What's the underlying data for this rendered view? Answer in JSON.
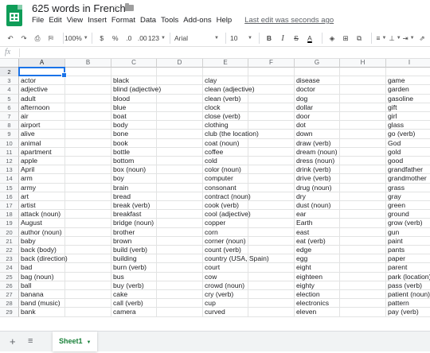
{
  "app": {
    "title": "625 words in French",
    "menu": [
      "File",
      "Edit",
      "View",
      "Insert",
      "Format",
      "Data",
      "Tools",
      "Add-ons",
      "Help"
    ],
    "last_edit": "Last edit was seconds ago",
    "accent": "#0f9d58"
  },
  "toolbar": {
    "zoom": "100%",
    "currency": "$",
    "percent": "%",
    "decimal_decrease": ".0",
    "decimal_increase": ".00",
    "more_formats": "123",
    "font": "Arial",
    "font_size": "10",
    "bold": "B",
    "italic": "I",
    "strike": "S",
    "text_color": "A"
  },
  "formula": {
    "fx": "fx",
    "value": ""
  },
  "grid": {
    "columns": [
      "A",
      "B",
      "C",
      "D",
      "E",
      "F",
      "G",
      "H",
      "I"
    ],
    "selected_column": "A",
    "active_cell": "A2",
    "rows": [
      {
        "n": "2",
        "cells": [
          "",
          "",
          "",
          "",
          "",
          "",
          "",
          "",
          ""
        ]
      },
      {
        "n": "3",
        "cells": [
          "actor",
          "",
          "black",
          "",
          "clay",
          "",
          "disease",
          "",
          "game"
        ]
      },
      {
        "n": "4",
        "cells": [
          "adjective",
          "",
          "blind (adjective)",
          "",
          "clean (adjective)",
          "",
          "doctor",
          "",
          "garden"
        ]
      },
      {
        "n": "5",
        "cells": [
          "adult",
          "",
          "blood",
          "",
          "clean (verb)",
          "",
          "dog",
          "",
          "gasoline"
        ]
      },
      {
        "n": "6",
        "cells": [
          "afternoon",
          "",
          "blue",
          "",
          "clock",
          "",
          "dollar",
          "",
          "gift"
        ]
      },
      {
        "n": "7",
        "cells": [
          "air",
          "",
          "boat",
          "",
          "close (verb)",
          "",
          "door",
          "",
          "girl"
        ]
      },
      {
        "n": "8",
        "cells": [
          "airport",
          "",
          "body",
          "",
          "clothing",
          "",
          "dot",
          "",
          "glass"
        ]
      },
      {
        "n": "9",
        "cells": [
          "alive",
          "",
          "bone",
          "",
          "club (the location)",
          "",
          "down",
          "",
          "go (verb)"
        ]
      },
      {
        "n": "10",
        "cells": [
          "animal",
          "",
          "book",
          "",
          "coat (noun)",
          "",
          "draw (verb)",
          "",
          "God"
        ]
      },
      {
        "n": "11",
        "cells": [
          "apartment",
          "",
          "bottle",
          "",
          "coffee",
          "",
          "dream (noun)",
          "",
          "gold"
        ]
      },
      {
        "n": "12",
        "cells": [
          "apple",
          "",
          "bottom",
          "",
          "cold",
          "",
          "dress (noun)",
          "",
          "good"
        ]
      },
      {
        "n": "13",
        "cells": [
          "April",
          "",
          "box (noun)",
          "",
          "color (noun)",
          "",
          "drink (verb)",
          "",
          "grandfather"
        ]
      },
      {
        "n": "14",
        "cells": [
          "arm",
          "",
          "boy",
          "",
          "computer",
          "",
          "drive (verb)",
          "",
          "grandmother"
        ]
      },
      {
        "n": "15",
        "cells": [
          "army",
          "",
          "brain",
          "",
          "consonant",
          "",
          "drug (noun)",
          "",
          "grass"
        ]
      },
      {
        "n": "16",
        "cells": [
          "art",
          "",
          "bread",
          "",
          "contract (noun)",
          "",
          "dry",
          "",
          "gray"
        ]
      },
      {
        "n": "17",
        "cells": [
          "artist",
          "",
          "break (verb)",
          "",
          "cook (verb)",
          "",
          "dust (noun)",
          "",
          "green"
        ]
      },
      {
        "n": "18",
        "cells": [
          "attack (noun)",
          "",
          "breakfast",
          "",
          "cool (adjective)",
          "",
          "ear",
          "",
          "ground"
        ]
      },
      {
        "n": "19",
        "cells": [
          "August",
          "",
          "bridge (noun)",
          "",
          "copper",
          "",
          "Earth",
          "",
          "grow (verb)"
        ]
      },
      {
        "n": "20",
        "cells": [
          "author (noun)",
          "",
          "brother",
          "",
          "corn",
          "",
          "east",
          "",
          "gun"
        ]
      },
      {
        "n": "21",
        "cells": [
          "baby",
          "",
          "brown",
          "",
          "corner (noun)",
          "",
          "eat (verb)",
          "",
          "paint"
        ]
      },
      {
        "n": "22",
        "cells": [
          "back (body)",
          "",
          "build (verb)",
          "",
          "count (verb)",
          "",
          "edge",
          "",
          "pants"
        ]
      },
      {
        "n": "23",
        "cells": [
          "back (direction)",
          "",
          "building",
          "",
          "country (USA, Spain)",
          "",
          "egg",
          "",
          "paper"
        ]
      },
      {
        "n": "24",
        "cells": [
          "bad",
          "",
          "burn (verb)",
          "",
          "court",
          "",
          "eight",
          "",
          "parent"
        ]
      },
      {
        "n": "25",
        "cells": [
          "bag (noun)",
          "",
          "bus",
          "",
          "cow",
          "",
          "eighteen",
          "",
          "park (location)"
        ]
      },
      {
        "n": "26",
        "cells": [
          "ball",
          "",
          "buy (verb)",
          "",
          "crowd (noun)",
          "",
          "eighty",
          "",
          "pass (verb)"
        ]
      },
      {
        "n": "27",
        "cells": [
          "banana",
          "",
          "cake",
          "",
          "cry (verb)",
          "",
          "election",
          "",
          "patient (noun)"
        ]
      },
      {
        "n": "28",
        "cells": [
          "band (music)",
          "",
          "call (verb)",
          "",
          "cup",
          "",
          "electronics",
          "",
          "pattern"
        ]
      },
      {
        "n": "29",
        "cells": [
          "bank",
          "",
          "camera",
          "",
          "curved",
          "",
          "eleven",
          "",
          "pay (verb)"
        ]
      }
    ]
  },
  "sheets": {
    "add": "+",
    "list": "≡",
    "active": "Sheet1"
  }
}
